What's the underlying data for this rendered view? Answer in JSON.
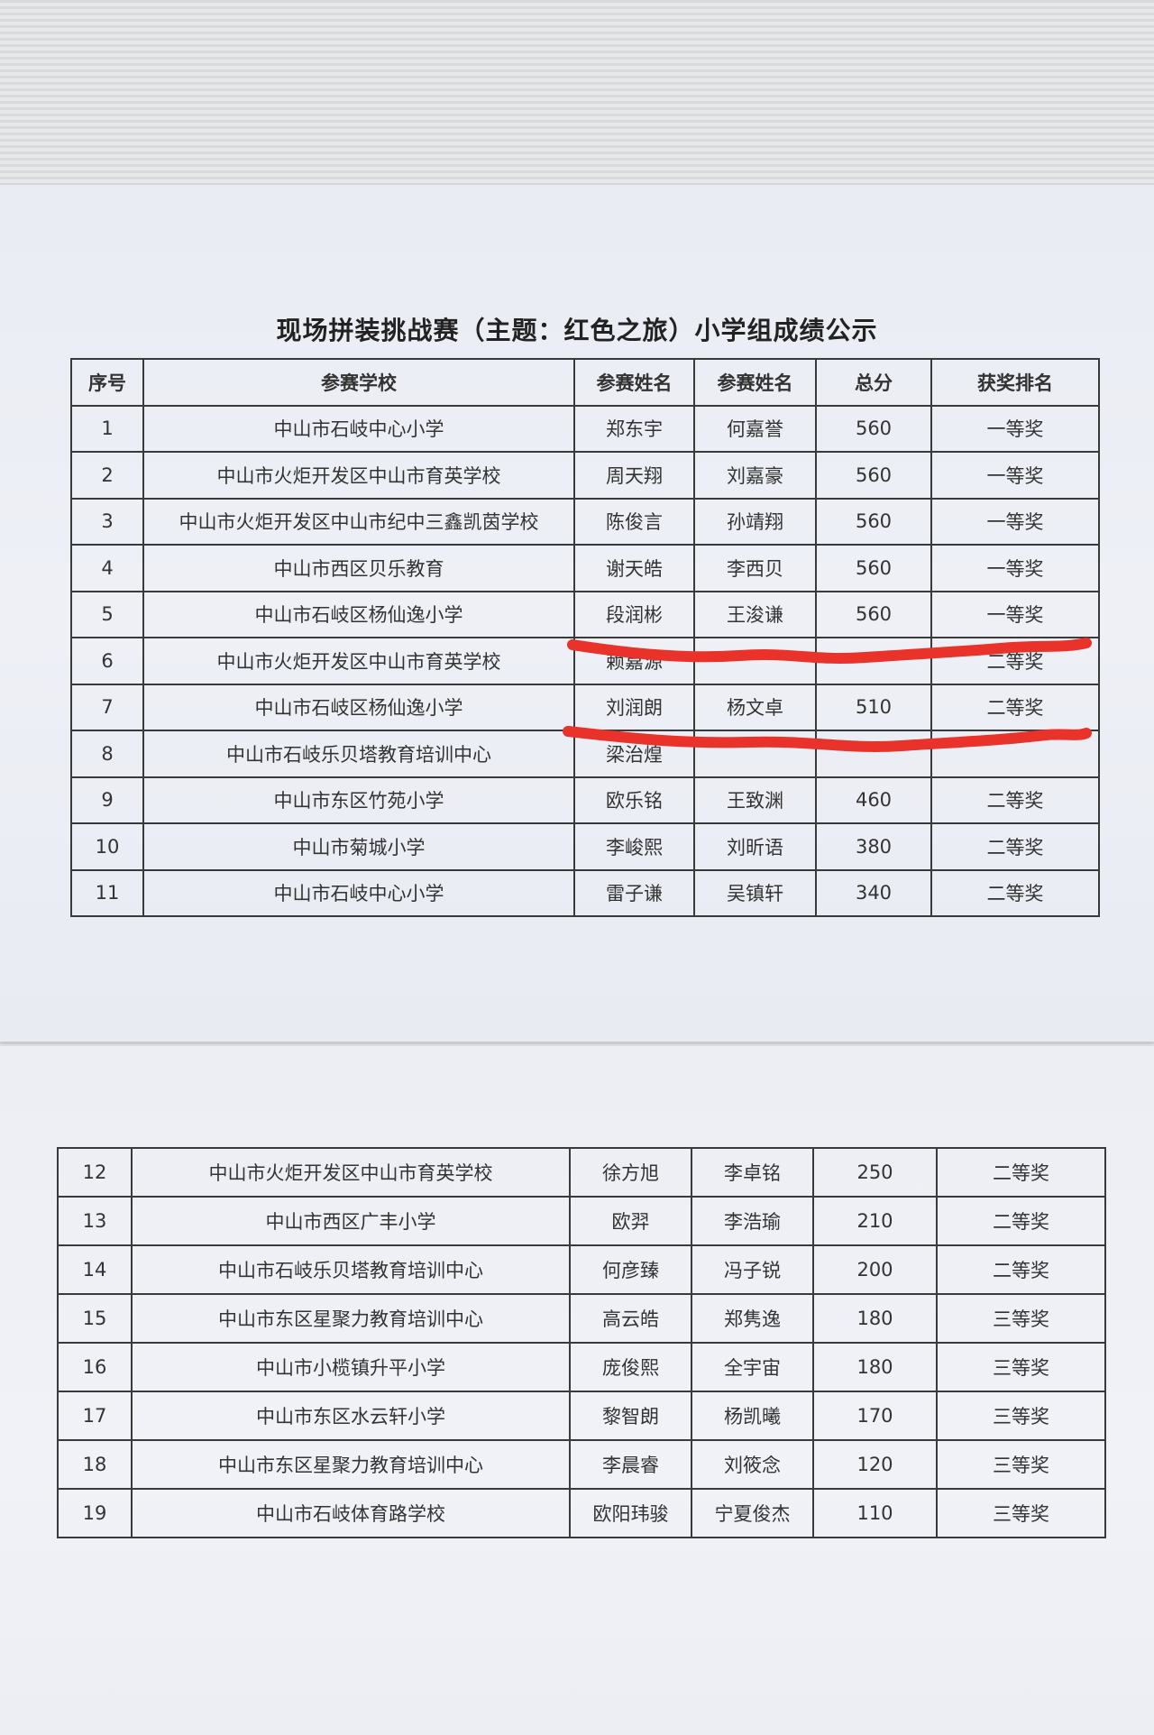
{
  "document": {
    "title": "现场拼装挑战赛（主题：红色之旅）小学组成绩公示"
  },
  "table": {
    "headers": [
      "序号",
      "参赛学校",
      "参赛姓名",
      "参赛姓名",
      "总分",
      "获奖排名"
    ],
    "rows_page1": [
      {
        "no": "1",
        "school": "中山市石岐中心小学",
        "name1": "郑东宇",
        "name2": "何嘉誉",
        "score": "560",
        "award": "一等奖"
      },
      {
        "no": "2",
        "school": "中山市火炬开发区中山市育英学校",
        "name1": "周天翔",
        "name2": "刘嘉豪",
        "score": "560",
        "award": "一等奖"
      },
      {
        "no": "3",
        "school": "中山市火炬开发区中山市纪中三鑫凯茵学校",
        "name1": "陈俊言",
        "name2": "孙靖翔",
        "score": "560",
        "award": "一等奖"
      },
      {
        "no": "4",
        "school": "中山市西区贝乐教育",
        "name1": "谢天皓",
        "name2": "李西贝",
        "score": "560",
        "award": "一等奖"
      },
      {
        "no": "5",
        "school": "中山市石岐区杨仙逸小学",
        "name1": "段润彬",
        "name2": "王浚谦",
        "score": "560",
        "award": "一等奖"
      },
      {
        "no": "6",
        "school": "中山市火炬开发区中山市育英学校",
        "name1": "赖嘉源",
        "name2": "",
        "score": "",
        "award": "二等奖"
      },
      {
        "no": "7",
        "school": "中山市石岐区杨仙逸小学",
        "name1": "刘润朗",
        "name2": "杨文卓",
        "score": "510",
        "award": "二等奖"
      },
      {
        "no": "8",
        "school": "中山市石岐乐贝塔教育培训中心",
        "name1": "梁治煌",
        "name2": "",
        "score": "",
        "award": ""
      },
      {
        "no": "9",
        "school": "中山市东区竹苑小学",
        "name1": "欧乐铭",
        "name2": "王致渊",
        "score": "460",
        "award": "二等奖"
      },
      {
        "no": "10",
        "school": "中山市菊城小学",
        "name1": "李峻熙",
        "name2": "刘昕语",
        "score": "380",
        "award": "二等奖"
      },
      {
        "no": "11",
        "school": "中山市石岐中心小学",
        "name1": "雷子谦",
        "name2": "吴镇轩",
        "score": "340",
        "award": "二等奖"
      }
    ],
    "rows_page2": [
      {
        "no": "12",
        "school": "中山市火炬开发区中山市育英学校",
        "name1": "徐方旭",
        "name2": "李卓铭",
        "score": "250",
        "award": "二等奖"
      },
      {
        "no": "13",
        "school": "中山市西区广丰小学",
        "name1": "欧羿",
        "name2": "李浩瑜",
        "score": "210",
        "award": "二等奖"
      },
      {
        "no": "14",
        "school": "中山市石岐乐贝塔教育培训中心",
        "name1": "何彦臻",
        "name2": "冯子锐",
        "score": "200",
        "award": "二等奖"
      },
      {
        "no": "15",
        "school": "中山市东区星聚力教育培训中心",
        "name1": "高云皓",
        "name2": "郑隽逸",
        "score": "180",
        "award": "三等奖"
      },
      {
        "no": "16",
        "school": "中山市小榄镇升平小学",
        "name1": "庞俊熙",
        "name2": "全宇宙",
        "score": "180",
        "award": "三等奖"
      },
      {
        "no": "17",
        "school": "中山市东区水云轩小学",
        "name1": "黎智朗",
        "name2": "杨凯曦",
        "score": "170",
        "award": "三等奖"
      },
      {
        "no": "18",
        "school": "中山市东区星聚力教育培训中心",
        "name1": "李晨睿",
        "name2": "刘筱念",
        "score": "120",
        "award": "三等奖"
      },
      {
        "no": "19",
        "school": "中山市石岐体育路学校",
        "name1": "欧阳玮骏",
        "name2": "宁夏俊杰",
        "score": "110",
        "award": "三等奖"
      }
    ]
  },
  "colors": {
    "marker_red": "#e8322a",
    "paper": "#eceef4",
    "ink": "#333333"
  }
}
